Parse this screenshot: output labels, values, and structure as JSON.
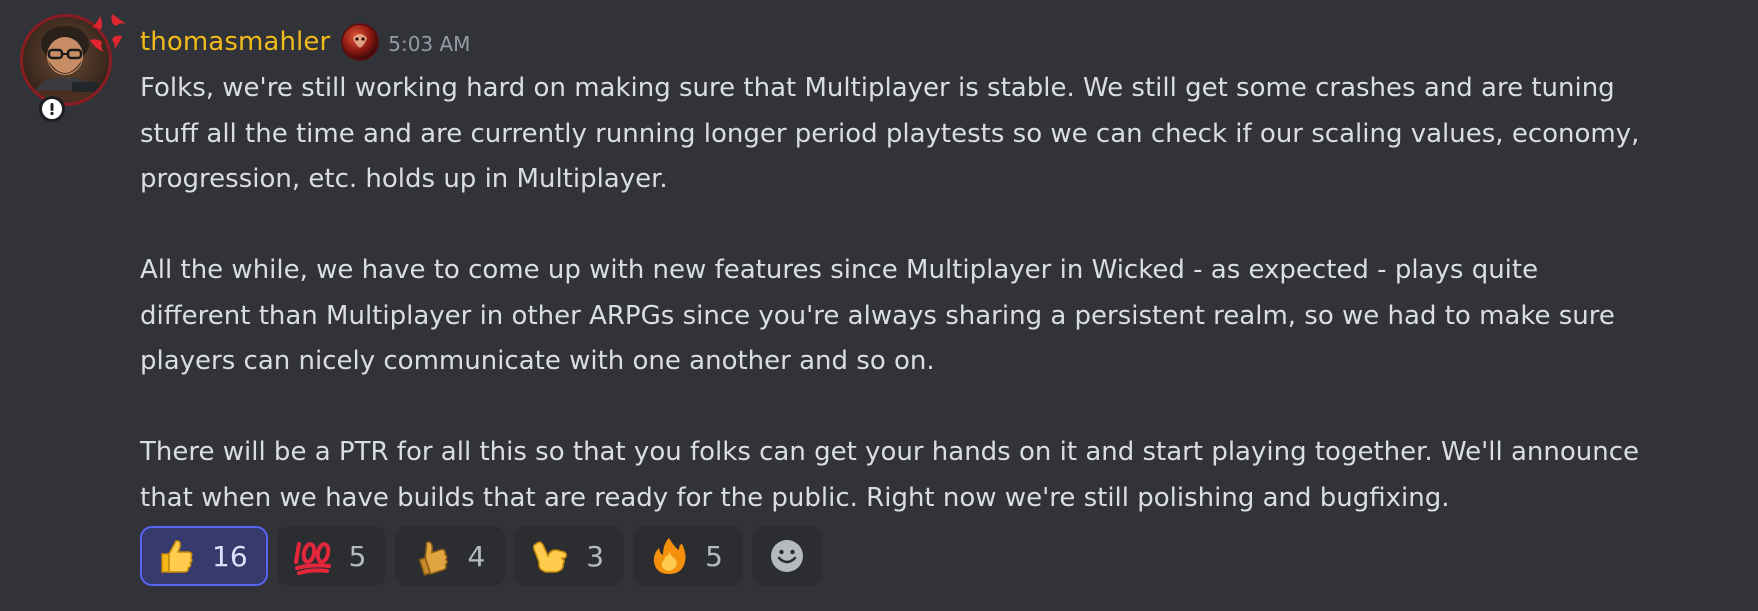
{
  "message": {
    "author": "thomasmahler",
    "timestamp": "5:03 AM",
    "paragraphs": [
      {
        "lines": [
          "Folks, we're still working hard on making sure that Multiplayer is stable. We still get some crashes and are tuning",
          "stuff all the time and are currently running longer period playtests so we can check if our scaling values, economy,",
          "progression, etc. holds up in Multiplayer."
        ]
      },
      {
        "lines": [
          "All the while, we have to come up with new features since Multiplayer in Wicked - as expected - plays quite",
          "different than Multiplayer in other ARPGs since you're always sharing a persistent realm, so we had to make sure",
          "players can nicely communicate with one another and so on."
        ]
      },
      {
        "lines": [
          "There will be a PTR for all this so that you folks can get your hands on it and start playing together. We'll announce",
          "that when we have builds that are ready for the public. Right now we're still polishing and bugfixing."
        ]
      }
    ]
  },
  "reactions": [
    {
      "emoji": "thumbs-up",
      "count": "16",
      "active": true
    },
    {
      "emoji": "hundred-points",
      "count": "5",
      "active": false
    },
    {
      "emoji": "thumbs-up-tan",
      "count": "4",
      "active": false
    },
    {
      "emoji": "call-me-hand",
      "count": "3",
      "active": false
    },
    {
      "emoji": "fire",
      "count": "5",
      "active": false
    }
  ],
  "colors": {
    "background": "#313338",
    "username": "#f2bb1b",
    "text": "#dbdee1",
    "timestamp": "#949ba4",
    "reaction_bg": "#2b2d31",
    "reaction_active_bg": "#373a6c",
    "reaction_active_border": "#5865f2"
  }
}
